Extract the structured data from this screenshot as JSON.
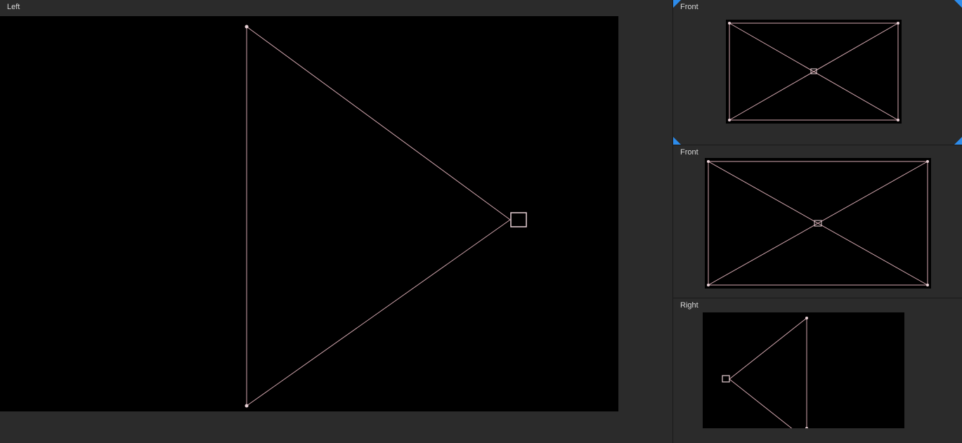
{
  "viewports": {
    "main": {
      "label": "Left"
    },
    "side1": {
      "label": "Front",
      "active": true
    },
    "side2": {
      "label": "Front"
    },
    "side3": {
      "label": "Right"
    }
  },
  "colors": {
    "wireframe": "#d4a8b0",
    "vertex": "#e8d0d5",
    "background": "#000000",
    "panel": "#2b2b2b",
    "activeMarker": "#2d8ceb"
  }
}
